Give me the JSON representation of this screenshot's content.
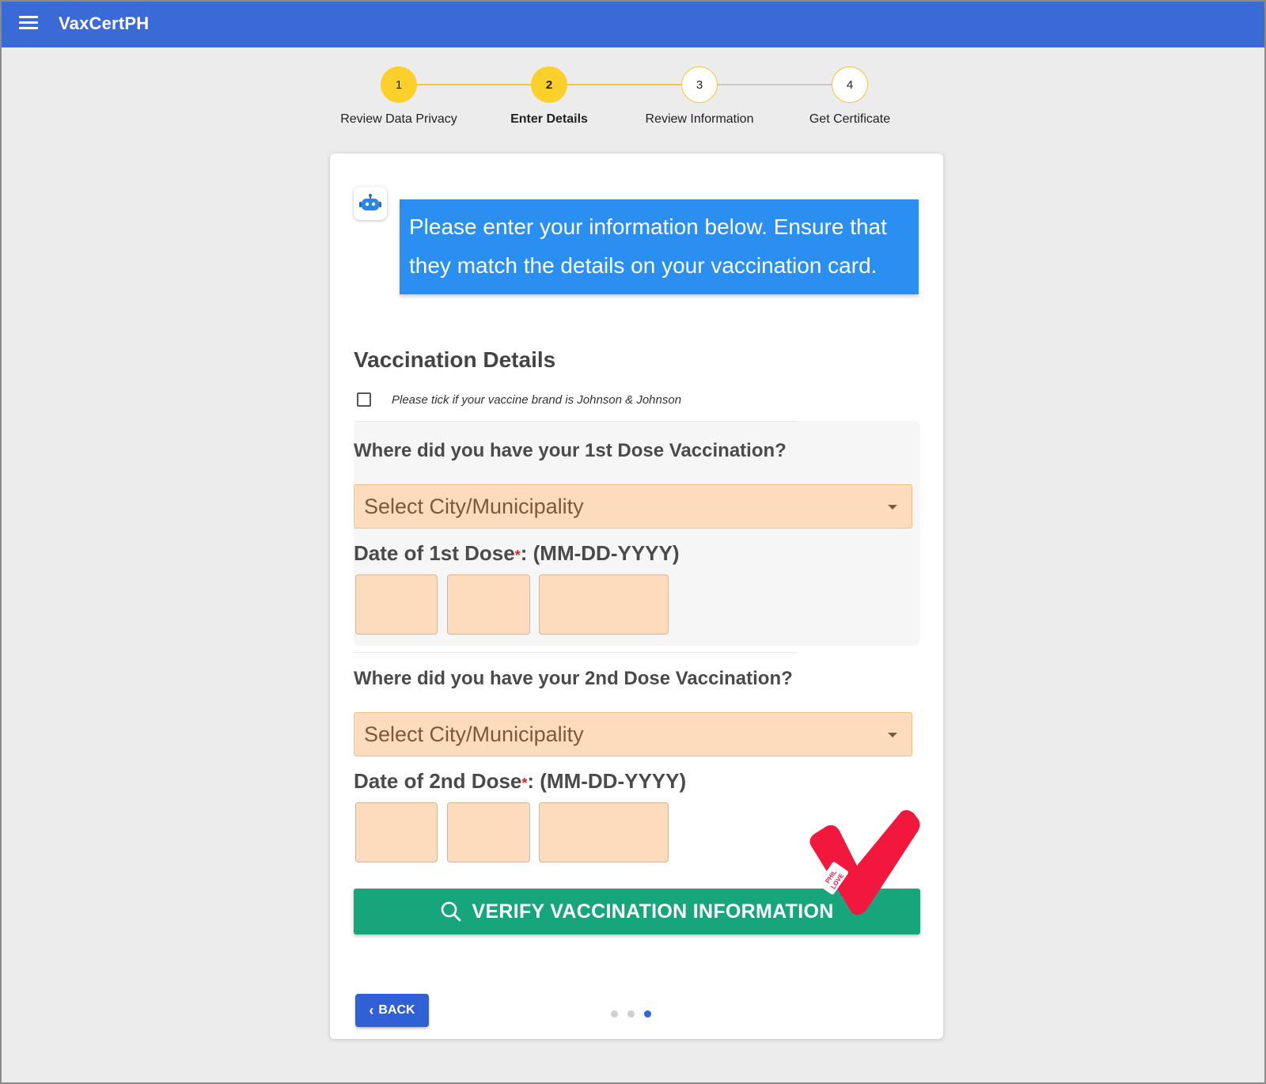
{
  "app": {
    "title": "VaxCertPH"
  },
  "stepper": {
    "steps": [
      {
        "number": "1",
        "label": "Review Data Privacy",
        "state": "done"
      },
      {
        "number": "2",
        "label": "Enter Details",
        "state": "active"
      },
      {
        "number": "3",
        "label": "Review Information",
        "state": "todo"
      },
      {
        "number": "4",
        "label": "Get Certificate",
        "state": "todo"
      }
    ]
  },
  "chat": {
    "message": "Please enter your information below. Ensure that they match the details on your vaccination card."
  },
  "form": {
    "section_title": "Vaccination Details",
    "jj_checkbox_label": "Please tick if your vaccine brand is Johnson & Johnson",
    "jj_checked": false,
    "dose1": {
      "question": "Where did you have your 1st Dose Vaccination?",
      "select_placeholder": "Select City/Municipality",
      "date_label": "Date of 1st Dose",
      "date_format": ": (MM-DD-YYYY)",
      "required_mark": "*"
    },
    "dose2": {
      "question": "Where did you have your 2nd Dose Vaccination?",
      "select_placeholder": "Select City/Municipality",
      "date_label": "Date of 2nd Dose",
      "date_format": ": (MM-DD-YYYY)",
      "required_mark": "*"
    },
    "verify_label": "VERIFY VACCINATION INFORMATION",
    "stamp_text": "PHIL LOVE"
  },
  "nav": {
    "back_label": "BACK",
    "pages_total": 3,
    "current_page": 3
  },
  "colors": {
    "appbar": "#3a6ad6",
    "step_active": "#fbd02b",
    "bubble": "#2a8ff0",
    "field_fill": "#fcdcbd",
    "verify": "#17a57c",
    "stamp": "#f2183d",
    "back": "#2f60d6"
  }
}
